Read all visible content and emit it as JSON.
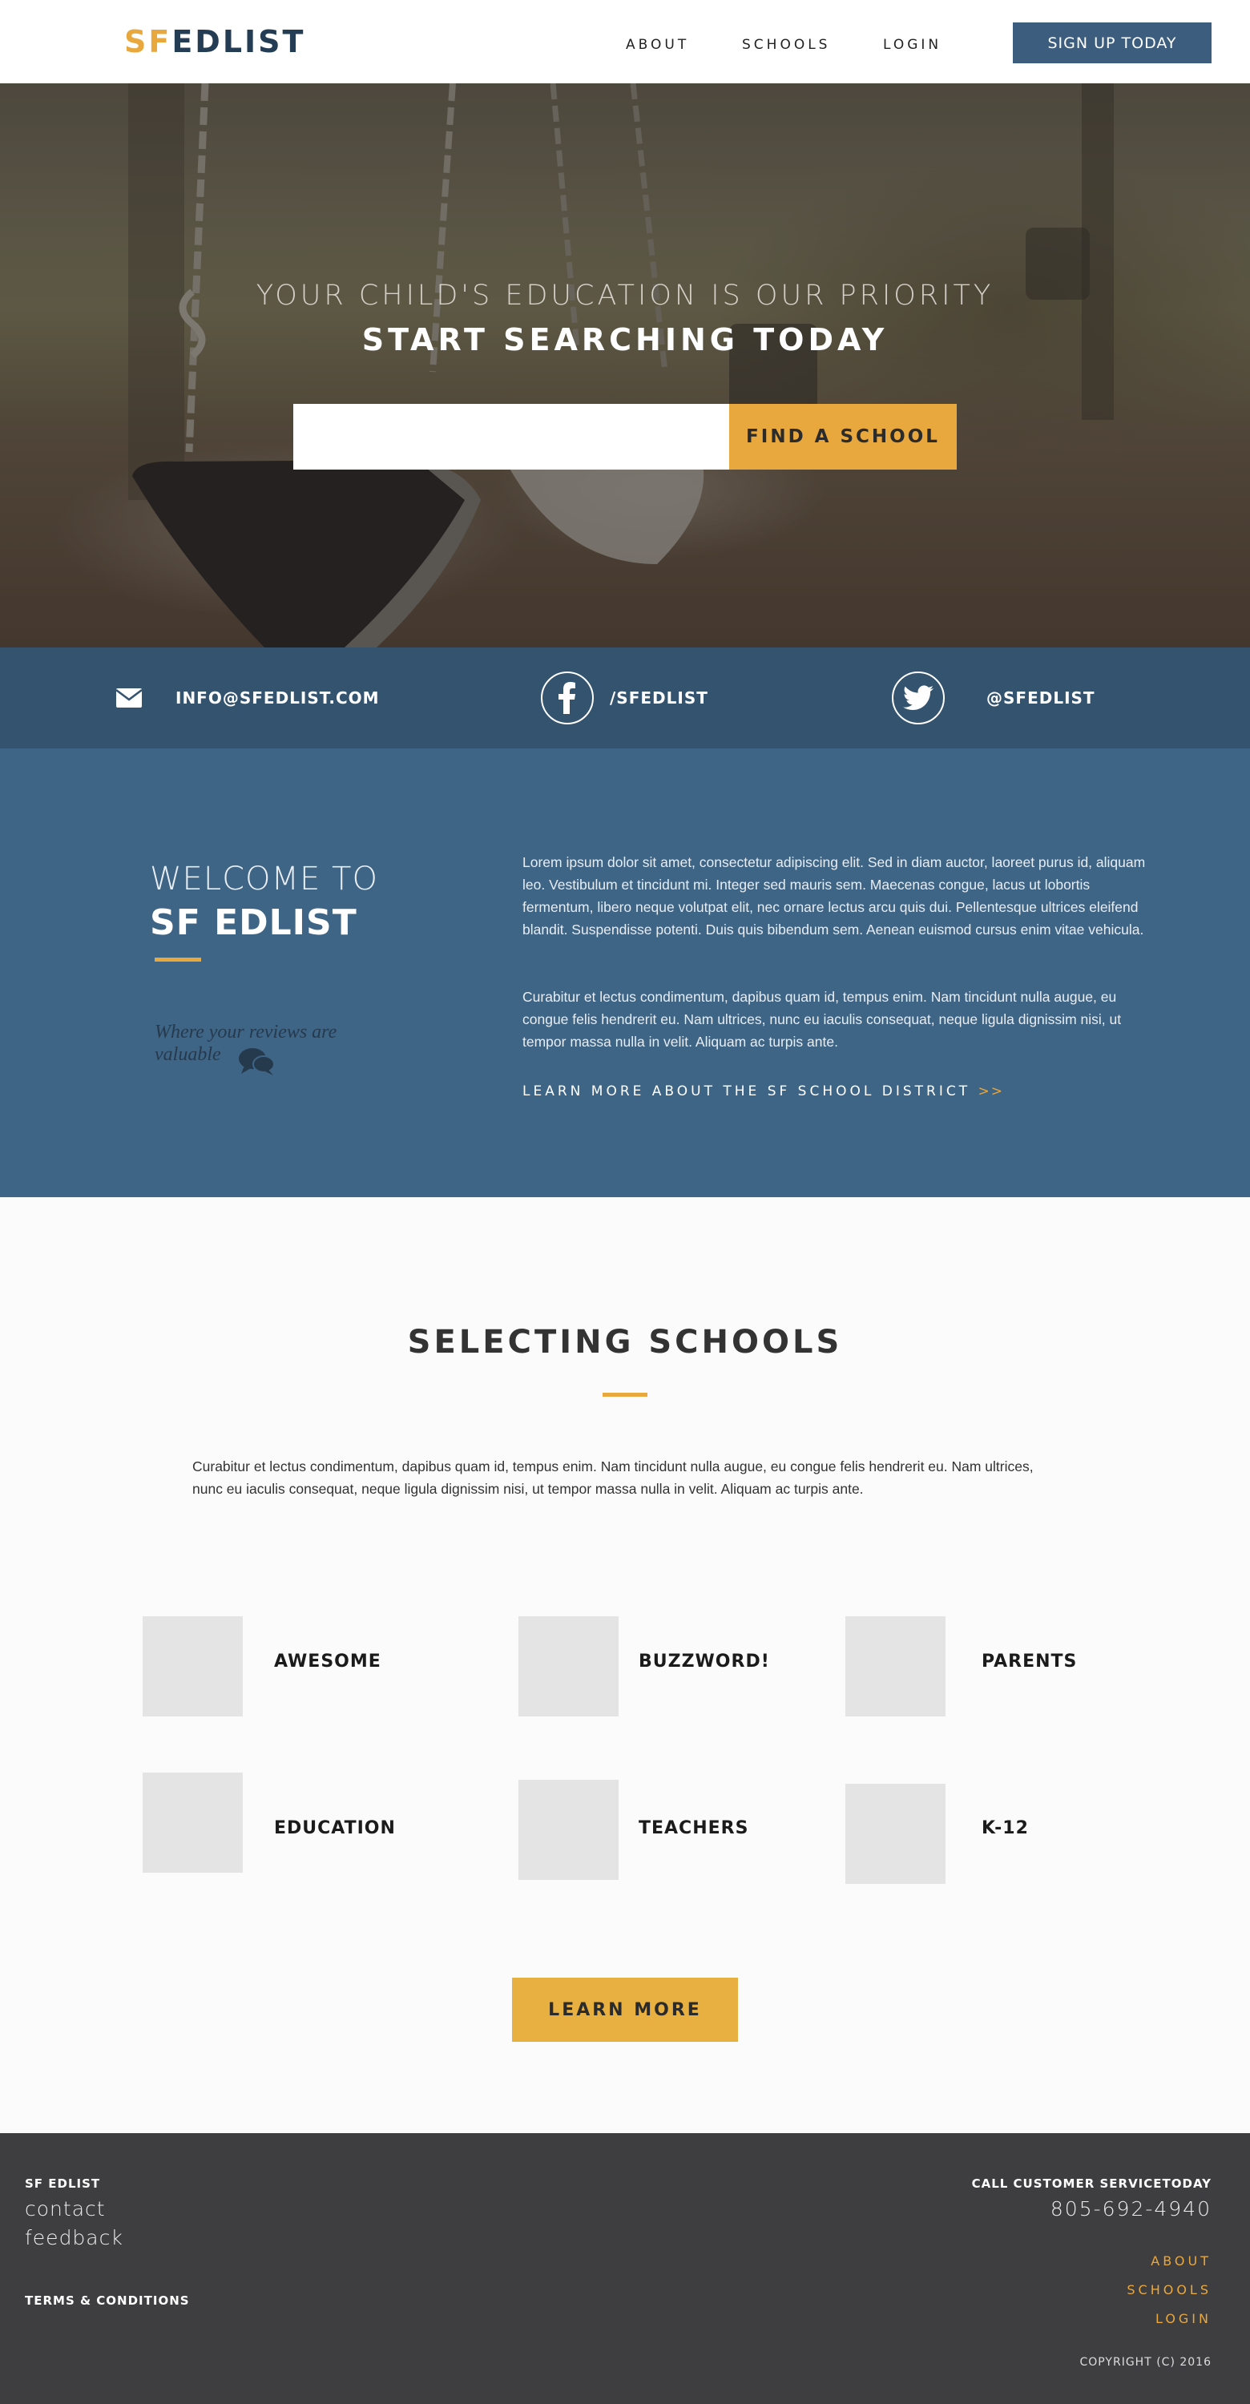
{
  "colors": {
    "brand_orange": "#e8a83e",
    "brand_navy": "#243d54",
    "contact_bar": "#34536f",
    "welcome_bg": "#3e6486",
    "footer_bg": "#3e3e40"
  },
  "nav": {
    "logo_sf": "SF",
    "logo_edlist": "EDLIST",
    "links": [
      "ABOUT",
      "SCHOOLS",
      "LOGIN"
    ],
    "signup_label": "SIGN UP TODAY"
  },
  "hero": {
    "subtitle": "YOUR CHILD'S EDUCATION IS OUR PRIORITY",
    "title": "START SEARCHING TODAY",
    "search_value": "",
    "find_label": "FIND A SCHOOL"
  },
  "contact": {
    "email": "INFO@SFEDLIST.COM",
    "facebook": "/SFEDLIST",
    "twitter": "@SFEDLIST",
    "icons": [
      "envelope-icon",
      "facebook-icon",
      "twitter-icon"
    ]
  },
  "welcome": {
    "pre": "WELCOME TO",
    "title": "SF EDLIST",
    "tagline": "Where your reviews are valuable",
    "para1": "Lorem ipsum dolor sit amet, consectetur adipiscing elit. Sed in diam auctor, laoreet purus id, aliquam leo. Vestibulum et tincidunt mi. Integer sed mauris sem. Maecenas congue, lacus ut lobortis fermentum, libero neque volutpat elit, nec ornare lectus arcu quis dui. Pellentesque ultrices eleifend blandit. Suspendisse potenti. Duis quis bibendum sem. Aenean euismod cursus enim vitae vehicula.",
    "para2": "Curabitur et lectus condimentum, dapibus quam id, tempus enim. Nam tincidunt nulla augue, eu congue felis hendrerit eu. Nam ultrices, nunc eu iaculis consequat, neque ligula dignissim nisi, ut tempor massa nulla in velit. Aliquam ac turpis ante.",
    "learn_link": "LEARN MORE ABOUT THE SF SCHOOL DISTRICT",
    "learn_arrow": ">>"
  },
  "selecting": {
    "title": "SELECTING SCHOOLS",
    "para": "Curabitur et lectus condimentum, dapibus quam id, tempus enim. Nam tincidunt nulla augue, eu congue felis hendrerit eu. Nam ultrices, nunc eu iaculis consequat, neque ligula dignissim nisi, ut tempor massa nulla in velit. Aliquam ac turpis ante.",
    "features": [
      "AWESOME",
      "BUZZWORD!",
      "PARENTS",
      "EDUCATION",
      "TEACHERS",
      "K-12"
    ],
    "learn_more": "LEARN MORE"
  },
  "footer": {
    "brand": "SF EDLIST",
    "contact": "contact",
    "feedback": "feedback",
    "terms": "TERMS & CONDITIONS",
    "call": "CALL CUSTOMER SERVICETODAY",
    "phone": "805-692-4940",
    "links": [
      "ABOUT",
      "SCHOOLS",
      "LOGIN"
    ],
    "copyright": "COPYRIGHT (C) 2016"
  }
}
